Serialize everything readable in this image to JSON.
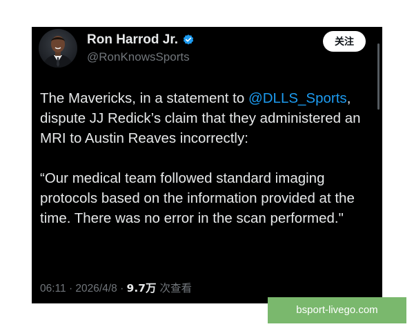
{
  "colors": {
    "card_background": "#000000",
    "primary_text": "#e7e9ea",
    "secondary_text": "#71767b",
    "mention_link": "#1d9bf0",
    "verified_badge": "#1d9bf0",
    "follow_button_bg": "#ffffff",
    "watermark_bg": "#7ab86d"
  },
  "author": {
    "display_name": "Ron Harrod Jr.",
    "verified": true,
    "verified_icon": "verified-check-badge-icon",
    "handle": "@RonKnowsSports",
    "avatar_icon": "profile-photo-avatar"
  },
  "follow_button": {
    "label": "关注"
  },
  "tweet": {
    "paragraph1": {
      "before_mention": "The Mavericks, in a statement to ",
      "mention": "@DLLS_Sports",
      "after_mention": ", dispute JJ Redick’s claim that they administered an MRI to Austin Reaves incorrectly:"
    },
    "paragraph2": "“Our medical team followed standard imaging protocols based on the information provided at the time. There was no error in the scan performed.\""
  },
  "meta": {
    "time": "06:11",
    "separator": " · ",
    "date": "2026/4/8",
    "views_count": "9.7万",
    "views_label": " 次查看"
  },
  "watermark": {
    "text": "bsport-livego.com"
  }
}
